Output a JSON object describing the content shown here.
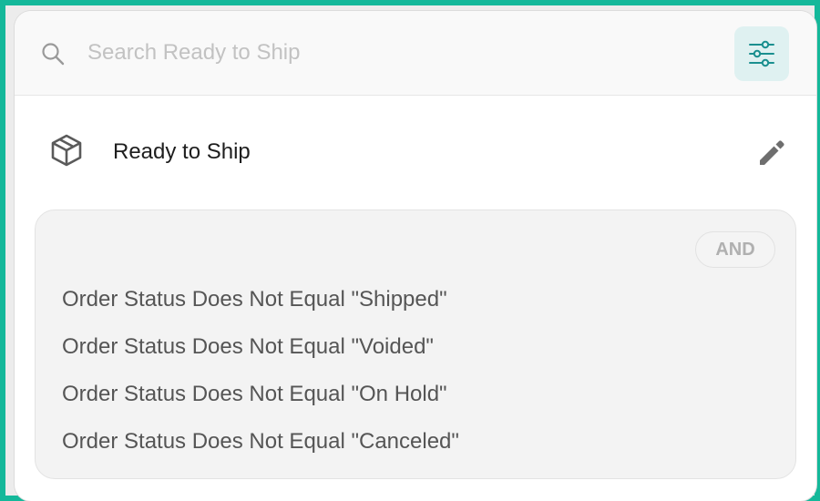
{
  "search": {
    "placeholder": "Search Ready to Ship",
    "value": ""
  },
  "icons": {
    "search": "search-icon",
    "filter": "sliders-icon",
    "view": "package-box-icon",
    "edit": "pencil-icon"
  },
  "colors": {
    "accent": "#1a8f8f",
    "filter_button_bg": "#dff1f1",
    "frame": "#14b89a"
  },
  "view": {
    "title": "Ready to Ship"
  },
  "rules": {
    "operator": "AND",
    "items": [
      "Order Status Does Not Equal \"Shipped\"",
      "Order Status Does Not Equal \"Voided\"",
      "Order Status Does Not Equal \"On Hold\"",
      "Order Status Does Not Equal \"Canceled\""
    ]
  }
}
